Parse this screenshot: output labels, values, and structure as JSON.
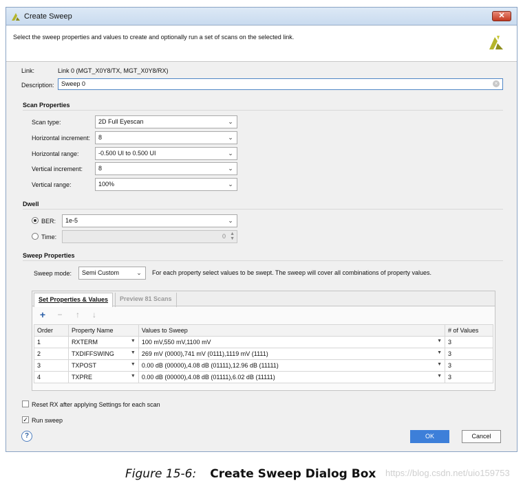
{
  "window": {
    "title": "Create Sweep",
    "close_label": "✕",
    "banner_text": "Select the sweep properties and values to create and optionally run a set of scans on the selected link."
  },
  "link": {
    "label": "Link:",
    "value": "Link 0 (MGT_X0Y8/TX, MGT_X0Y8/RX)"
  },
  "description": {
    "label": "Description:",
    "value": "Sweep 0"
  },
  "scan_properties": {
    "title": "Scan Properties",
    "scan_type": {
      "label": "Scan type:",
      "value": "2D Full Eyescan"
    },
    "horizontal_increment": {
      "label": "Horizontal increment:",
      "value": "8"
    },
    "horizontal_range": {
      "label": "Horizontal range:",
      "value": "-0.500 UI to 0.500 UI"
    },
    "vertical_increment": {
      "label": "Vertical increment:",
      "value": "8"
    },
    "vertical_range": {
      "label": "Vertical range:",
      "value": "100%"
    }
  },
  "dwell": {
    "title": "Dwell",
    "ber": {
      "label": "BER:",
      "value": "1e-5",
      "selected": true
    },
    "time": {
      "label": "Time:",
      "value": "0",
      "selected": false
    }
  },
  "sweep_properties": {
    "title": "Sweep Properties",
    "mode_label": "Sweep mode:",
    "mode_value": "Semi Custom",
    "mode_hint": "For each property select values to be swept. The sweep will cover all combinations of property values.",
    "tabs": [
      {
        "label": "Set Properties & Values"
      },
      {
        "label": "Preview 81 Scans"
      }
    ],
    "toolbar": {
      "add": "+",
      "remove": "−",
      "up": "↑",
      "down": "↓"
    },
    "columns": [
      "Order",
      "Property Name",
      "Values to Sweep",
      "# of Values"
    ],
    "rows": [
      {
        "order": "1",
        "property": "RXTERM",
        "values": "100 mV,550 mV,1100 mV",
        "count": "3"
      },
      {
        "order": "2",
        "property": "TXDIFFSWING",
        "values": "269 mV (0000),741 mV (0111),1119 mV (1111)",
        "count": "3"
      },
      {
        "order": "3",
        "property": "TXPOST",
        "values": "0.00 dB (00000),4.08 dB (01111),12.96 dB (11111)",
        "count": "3"
      },
      {
        "order": "4",
        "property": "TXPRE",
        "values": "0.00 dB (00000),4.08 dB (01111),6.02 dB (11111)",
        "count": "3"
      }
    ]
  },
  "options": {
    "reset_rx": {
      "label": "Reset RX after applying Settings for each scan",
      "checked": false
    },
    "run_sweep": {
      "label": "Run sweep",
      "checked": true
    }
  },
  "buttons": {
    "help": "?",
    "ok": "OK",
    "cancel": "Cancel"
  },
  "caption": {
    "figure": "Figure 15-6:",
    "title": "Create Sweep Dialog Box"
  },
  "watermark": "https://blog.csdn.net/uio159753",
  "colors": {
    "accent": "#3d7fd9",
    "logo": "#b5b52a",
    "close": "#c43a22"
  },
  "icons": [
    "app-logo-icon",
    "close-icon",
    "vivado-logo-icon",
    "chevron-down-icon",
    "add-icon",
    "remove-icon",
    "move-up-icon",
    "move-down-icon",
    "help-icon",
    "clear-icon",
    "spinner-icon"
  ]
}
